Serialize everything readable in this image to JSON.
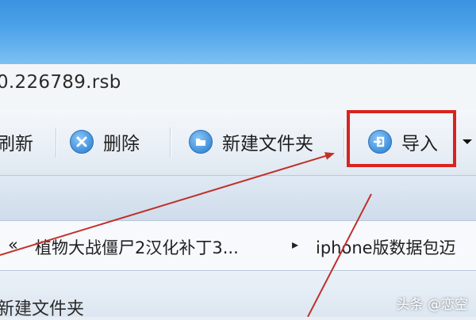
{
  "path": {
    "text": "0.226789.rsb"
  },
  "toolbar": {
    "refresh_label": "刷新",
    "delete_label": "删除",
    "new_folder_label": "新建文件夹",
    "import_label": "导入"
  },
  "breadcrumb": {
    "overflow": "«",
    "item1": "植物大战僵尸2汉化补丁3...",
    "separator": "▸",
    "item2": "iphone版数据包迈"
  },
  "list": {
    "first_item": "新建文件夹"
  },
  "watermark": "头条 @恋空",
  "colors": {
    "highlight": "#d9231e",
    "accent": "#3f8fdc"
  },
  "icons": [
    "delete-icon",
    "new-folder-icon",
    "import-icon",
    "dropdown-arrow-icon"
  ]
}
